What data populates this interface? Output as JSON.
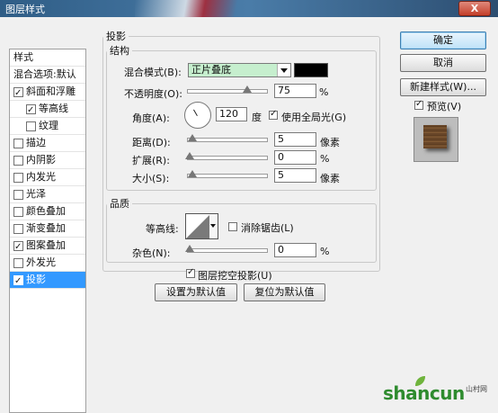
{
  "window": {
    "title": "图层样式",
    "close_symbol": "X"
  },
  "style_list": [
    {
      "label": "样式",
      "checkbox": false,
      "checked": false,
      "indent": 0,
      "selected": false
    },
    {
      "label": "混合选项:默认",
      "checkbox": false,
      "checked": false,
      "indent": 0,
      "selected": false
    },
    {
      "label": "斜面和浮雕",
      "checkbox": true,
      "checked": true,
      "indent": 0,
      "selected": false
    },
    {
      "label": "等高线",
      "checkbox": true,
      "checked": true,
      "indent": 1,
      "selected": false
    },
    {
      "label": "纹理",
      "checkbox": true,
      "checked": false,
      "indent": 1,
      "selected": false
    },
    {
      "label": "描边",
      "checkbox": true,
      "checked": false,
      "indent": 0,
      "selected": false
    },
    {
      "label": "内阴影",
      "checkbox": true,
      "checked": false,
      "indent": 0,
      "selected": false
    },
    {
      "label": "内发光",
      "checkbox": true,
      "checked": false,
      "indent": 0,
      "selected": false
    },
    {
      "label": "光泽",
      "checkbox": true,
      "checked": false,
      "indent": 0,
      "selected": false
    },
    {
      "label": "颜色叠加",
      "checkbox": true,
      "checked": false,
      "indent": 0,
      "selected": false
    },
    {
      "label": "渐变叠加",
      "checkbox": true,
      "checked": false,
      "indent": 0,
      "selected": false
    },
    {
      "label": "图案叠加",
      "checkbox": true,
      "checked": true,
      "indent": 0,
      "selected": false
    },
    {
      "label": "外发光",
      "checkbox": true,
      "checked": false,
      "indent": 0,
      "selected": false
    },
    {
      "label": "投影",
      "checkbox": true,
      "checked": true,
      "indent": 0,
      "selected": true
    }
  ],
  "drop_shadow": {
    "section_title": "投影",
    "structure_title": "结构",
    "blend_mode_label": "混合模式(B):",
    "blend_mode_value": "正片叠底",
    "blend_color": "#000000",
    "opacity_label": "不透明度(O):",
    "opacity_value": "75",
    "opacity_unit": "%",
    "angle_label": "角度(A):",
    "angle_value": "120",
    "angle_unit": "度",
    "global_light_label": "使用全局光(G)",
    "global_light_checked": true,
    "distance_label": "距离(D):",
    "distance_value": "5",
    "distance_unit": "像素",
    "spread_label": "扩展(R):",
    "spread_value": "0",
    "spread_unit": "%",
    "size_label": "大小(S):",
    "size_value": "5",
    "size_unit": "像素",
    "quality_title": "品质",
    "contour_label": "等高线:",
    "anti_alias_label": "消除锯齿(L)",
    "anti_alias_checked": false,
    "noise_label": "杂色(N):",
    "noise_value": "0",
    "noise_unit": "%",
    "knockout_label": "图层挖空投影(U)",
    "knockout_checked": true,
    "make_default_label": "设置为默认值",
    "reset_default_label": "复位为默认值"
  },
  "buttons": {
    "ok": "确定",
    "cancel": "取消",
    "new_style": "新建样式(W)...",
    "preview_label": "预览(V)",
    "preview_checked": true
  },
  "watermark": {
    "text": "shancun",
    "small_text": "山村网"
  },
  "colors": {
    "selected": "#3399ff",
    "blend_highlight": "#c6efce",
    "title_bar": "#3a6b96"
  }
}
